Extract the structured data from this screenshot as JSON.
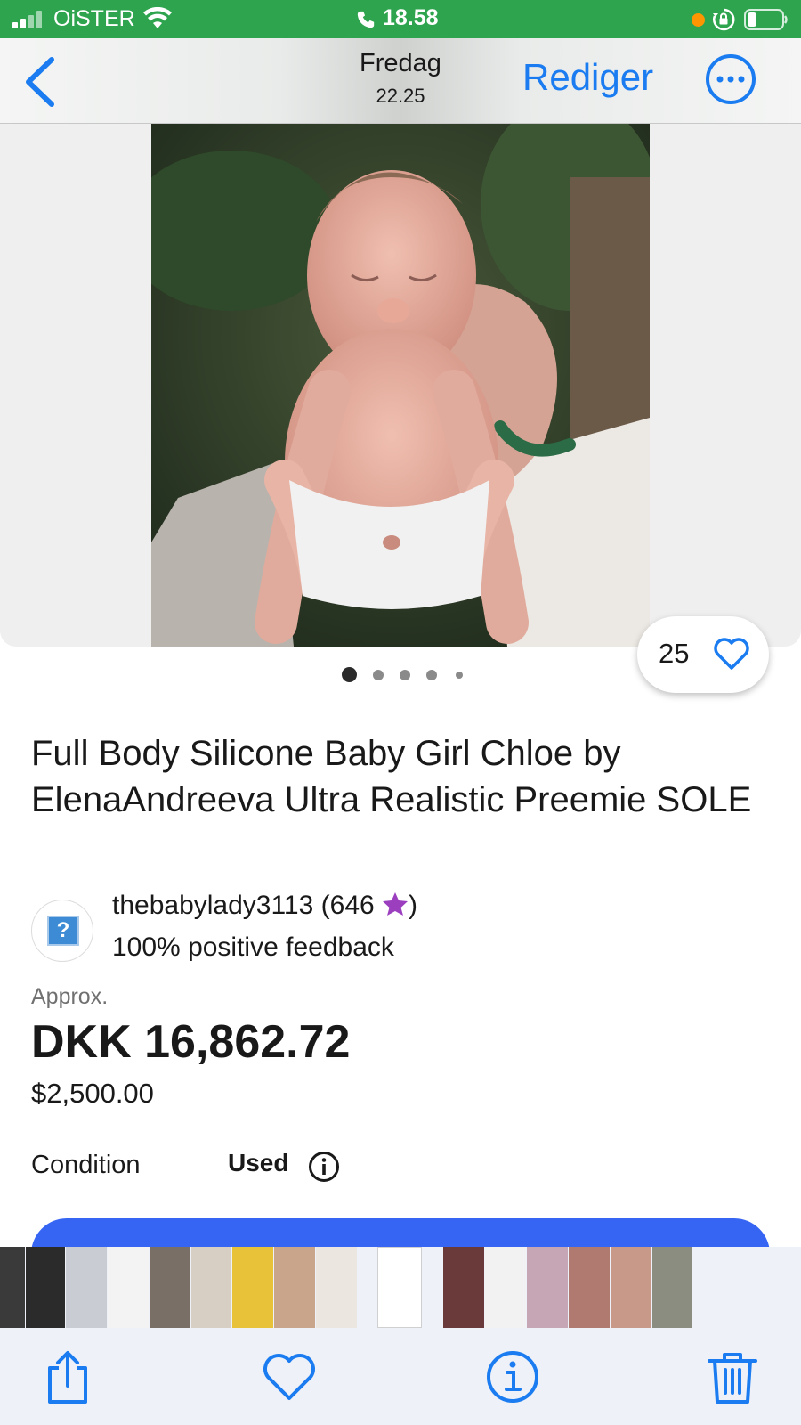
{
  "status_bar": {
    "carrier": "OiSTER",
    "time": "18.58",
    "recording_dot_color": "#ff9500",
    "background_color": "#2ea44f",
    "icons": [
      "signal-icon",
      "wifi-icon",
      "phone-icon",
      "orientation-lock-icon",
      "battery-icon"
    ]
  },
  "nav": {
    "back_icon": "chevron-left-icon",
    "day": "Fredag",
    "time": "22.25",
    "edit_label": "Rediger",
    "more_icon": "ellipsis-circle-icon",
    "accent_color": "#1a7cf0"
  },
  "listing": {
    "image_description_icon": "product-photo",
    "carousel": {
      "count": 5,
      "active": 0
    },
    "watchers": "25",
    "title": "Full Body Silicone Baby Girl Chloe by ElenaAndreeva Ultra Realistic Preemie SOLE",
    "seller": {
      "name": "thebabylady3113 (646",
      "close_paren": ")",
      "feedback": "100% positive feedback",
      "star_color": "#9b3fbf"
    },
    "price": {
      "approx_label": "Approx.",
      "local": "DKK 16,862.72",
      "original": "$2,500.00"
    },
    "condition": {
      "label": "Condition",
      "value": "Used"
    },
    "buy_button_color": "#3665f3"
  },
  "photos_bar": {
    "thumbnail_count": 17,
    "toolbar": [
      "share-icon",
      "heart-icon",
      "info-icon",
      "trash-icon"
    ]
  }
}
